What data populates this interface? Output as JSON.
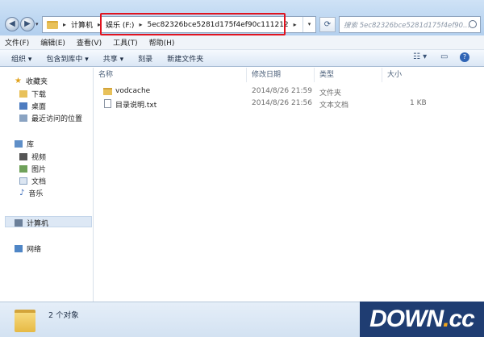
{
  "address": {
    "segments": [
      "计算机",
      "娱乐 (F:)",
      "5ec82326bce5281d175f4ef90c111212"
    ]
  },
  "search": {
    "placeholder": "搜索 5ec82326bce5281d175f4ef90..."
  },
  "menu": [
    "文件(F)",
    "编辑(E)",
    "查看(V)",
    "工具(T)",
    "帮助(H)"
  ],
  "toolbar": [
    "组织 ▾",
    "包含到库中 ▾",
    "共享 ▾",
    "刻录",
    "新建文件夹"
  ],
  "nav": {
    "favorites_label": "收藏夹",
    "favorites": [
      "下载",
      "桌面",
      "最近访问的位置"
    ],
    "library_label": "库",
    "library": [
      "视频",
      "图片",
      "文档",
      "音乐"
    ],
    "computer_label": "计算机",
    "network_label": "网络"
  },
  "columns": [
    "名称",
    "修改日期",
    "类型",
    "大小"
  ],
  "files": [
    {
      "name": "vodcache",
      "modified": "2014/8/26 21:59",
      "type": "文件夹",
      "size": ""
    },
    {
      "name": "目录说明.txt",
      "modified": "2014/8/26 21:56",
      "type": "文本文档",
      "size": "1 KB"
    }
  ],
  "status": {
    "count": "2 个对象"
  },
  "watermark": {
    "text": "DOWN",
    "dot": ".",
    "suffix": "cc"
  },
  "colors": {
    "highlight": "#e0131f",
    "folder": "#e8c15a"
  }
}
